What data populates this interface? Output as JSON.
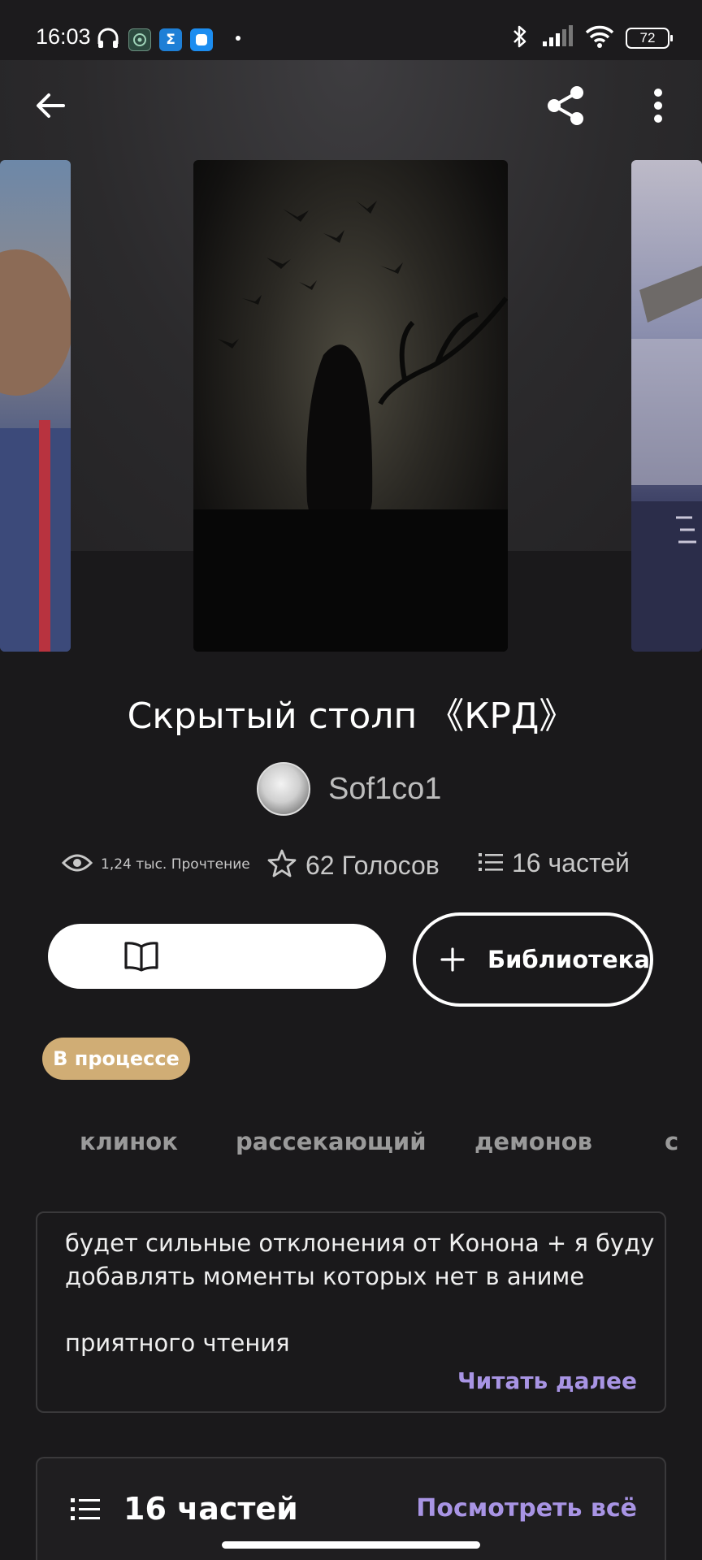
{
  "status_bar": {
    "time": "16:03",
    "battery": "72",
    "icons": [
      "headphones-icon",
      "app-icon-1",
      "sigma-app-icon",
      "blue-app-icon",
      "bluetooth-icon",
      "signal-icon",
      "wifi-icon",
      "battery-icon"
    ]
  },
  "toolbar": {
    "back_icon": "arrow-left-icon",
    "share_icon": "share-icon",
    "more_icon": "more-vertical-icon"
  },
  "story": {
    "title": "Скрытый столп 《КРД》",
    "author": "Sof1co1",
    "reads": "1,24 тыс. Прочтение",
    "votes": "62 Голосов",
    "parts": "16 частей",
    "status": "В процессе"
  },
  "actions": {
    "library_label": "Библиотека"
  },
  "tags": [
    "клинок",
    "рассекающий",
    "демонов",
    "с"
  ],
  "description": {
    "lines": [
      "будет сильные отклонения от Конона + я буду",
      "добавлять моменты которых нет в аниме",
      "",
      "приятного чтения"
    ],
    "read_more": "Читать далее"
  },
  "parts_section": {
    "title": "16 частей",
    "see_all": "Посмотреть всё"
  },
  "colors": {
    "background": "#1a191b",
    "accent": "#a894e4",
    "badge": "#d0ad75"
  }
}
